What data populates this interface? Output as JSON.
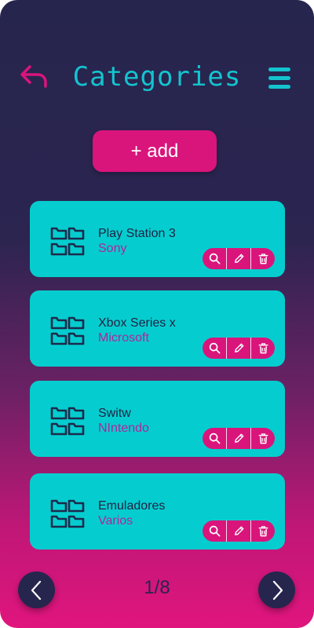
{
  "header": {
    "title": "Categories",
    "back_icon": "back-arrow-icon",
    "menu_icon": "hamburger-menu-icon"
  },
  "add_button": {
    "label": "+ add"
  },
  "categories": [
    {
      "name": "Play Station 3",
      "subtitle": "Sony"
    },
    {
      "name": "Xbox Series x",
      "subtitle": "Microsoft"
    },
    {
      "name": "Switw",
      "subtitle": "NIntendo"
    },
    {
      "name": "Emuladores",
      "subtitle": "Varios"
    }
  ],
  "card_actions": [
    "search-icon",
    "edit-pencil-icon",
    "trash-icon"
  ],
  "pagination": {
    "indicator": "1/8"
  },
  "colors": {
    "accent_cyan": "#05cdcf",
    "accent_pink": "#d9157b",
    "dark_navy": "#26254e",
    "subtitle_magenta": "#b0259a"
  }
}
